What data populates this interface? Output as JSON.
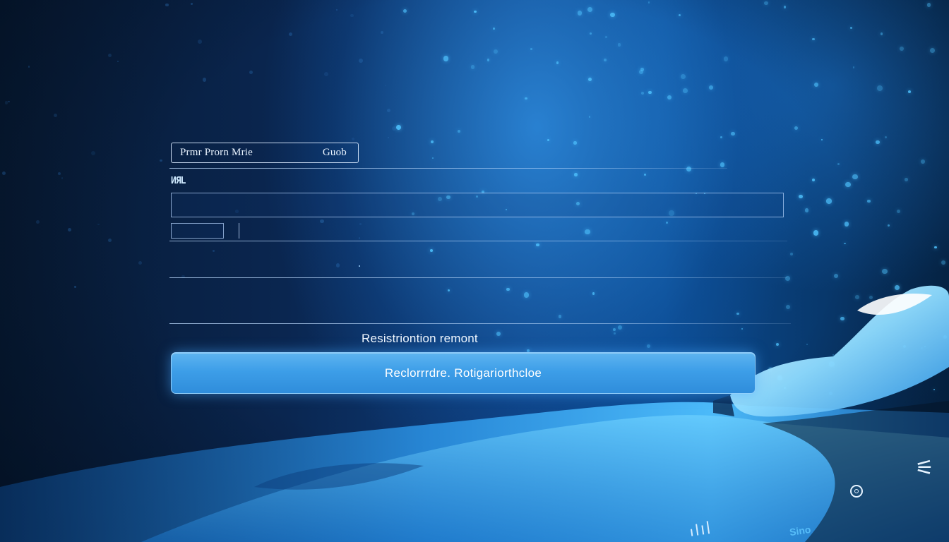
{
  "form": {
    "top_tab": {
      "left_label": "Prmr Prorn Mrie",
      "right_label": "Guob"
    },
    "field_label": "ИЯL",
    "inputs": {
      "main_value": "",
      "small_value": "",
      "long_value": ""
    },
    "registration_text": "Resistriontion remont",
    "submit_label": "Reclorrrdre. Rotigariorthcloe"
  },
  "device": {
    "bottom_label": "Sino"
  },
  "colors": {
    "accent": "#3d9ee8",
    "background_dark": "#071a33",
    "particle": "#4fc3ff"
  }
}
